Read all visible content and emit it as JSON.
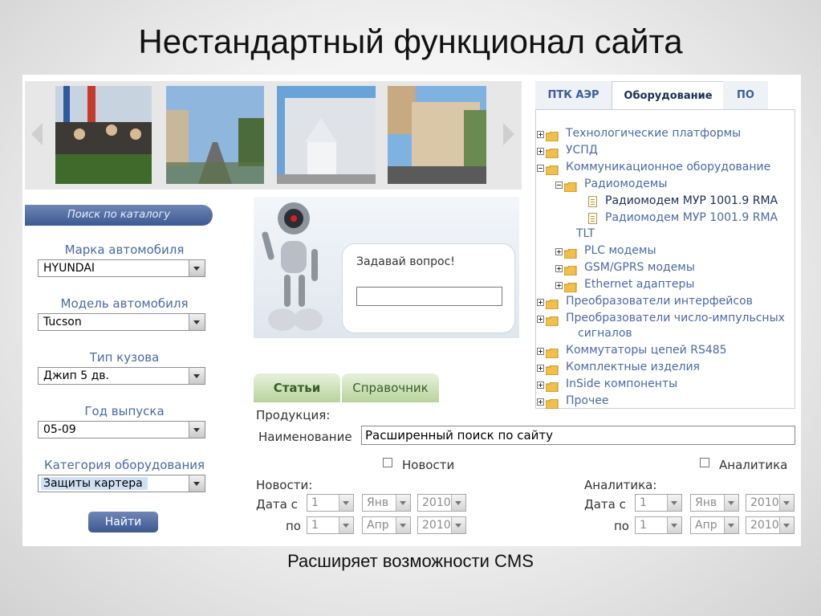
{
  "slide": {
    "title": "Нестандартный функционал сайта",
    "caption": "Расширяет возможности CMS"
  },
  "catalog": {
    "header": "Поиск по каталогу",
    "fields": [
      {
        "label": "Марка автомобиля",
        "value": "HYUNDAI"
      },
      {
        "label": "Модель автомобиля",
        "value": "Tucson"
      },
      {
        "label": "Тип кузова",
        "value": "Джип 5 дв."
      },
      {
        "label": "Год выпуска",
        "value": "05-09"
      },
      {
        "label": "Категория оборудования",
        "value": "Защиты картера"
      }
    ],
    "find_button": "Найти"
  },
  "robot": {
    "question_label": "Задавай вопрос!",
    "question_value": ""
  },
  "tabs": [
    "Статьи",
    "Справочник"
  ],
  "search_form": {
    "section_label": "Продукция:",
    "name_label": "Наименование",
    "name_value": "Расширенный поиск по сайту",
    "check_news": "Новости",
    "check_analytics": "Аналитика",
    "news_label": "Новости:",
    "analytics_label": "Аналитика:",
    "date_from": "Дата с",
    "date_to": "по",
    "news_from": {
      "day": "1",
      "month": "Янв",
      "year": "2010"
    },
    "news_to": {
      "day": "1",
      "month": "Апр",
      "year": "2010"
    },
    "analytics_from": {
      "day": "1",
      "month": "Янв",
      "year": "2010"
    },
    "analytics_to": {
      "day": "1",
      "month": "Апр",
      "year": "2010"
    }
  },
  "tree": {
    "tabs": [
      "ПТК АЭР",
      "Оборудование",
      "ПО"
    ],
    "nodes": [
      "Технологические платформы",
      "УСПД",
      "Коммуникационное оборудование",
      "Радиомодемы",
      "Радиомодем МУР 1001.9 RMA",
      "Радиомодем МУР 1001.9 RMA",
      "TLT",
      "PLC модемы",
      "GSM/GPRS модемы",
      "Ethernet адаптеры",
      "Преобразователи интерфейсов",
      "Преобразователи число-импульсных",
      "сигналов",
      "Коммутаторы цепей RS485",
      "Комплектные изделия",
      "InSide компоненты",
      "Прочее"
    ]
  },
  "colors": {
    "accent": "#3d5992",
    "link": "#4a6aa4",
    "tab_green": "#b9d39c"
  }
}
